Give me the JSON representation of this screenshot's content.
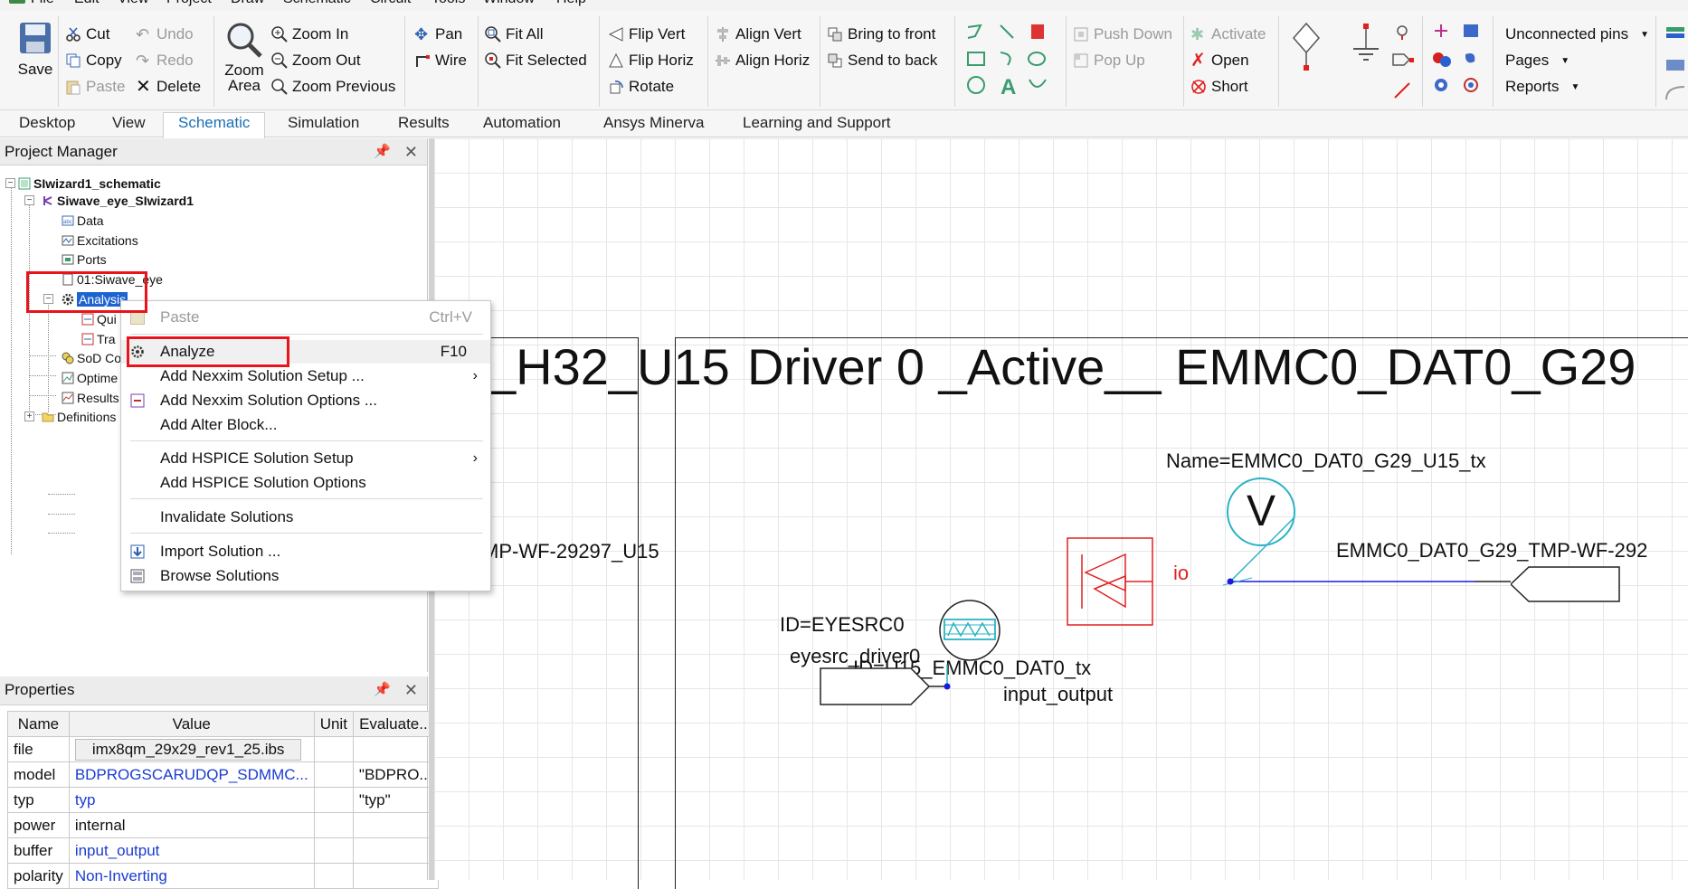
{
  "menubar": [
    "File",
    "Edit",
    "View",
    "Project",
    "Draw",
    "Schematic",
    "Circuit",
    "Tools",
    "Window",
    "Help"
  ],
  "ribbon": {
    "save": "Save",
    "cut": "Cut",
    "copy": "Copy",
    "paste": "Paste",
    "undo": "Undo",
    "redo": "Redo",
    "delete": "Delete",
    "zoom_area_1": "Zoom",
    "zoom_area_2": "Area",
    "zoom_in": "Zoom In",
    "zoom_out": "Zoom Out",
    "zoom_previous": "Zoom Previous",
    "pan": "Pan",
    "wire": "Wire",
    "fit_all": "Fit All",
    "fit_selected": "Fit Selected",
    "flip_vert": "Flip Vert",
    "flip_horiz": "Flip Horiz",
    "rotate": "Rotate",
    "align_vert": "Align Vert",
    "align_horiz": "Align Horiz",
    "bring_to_front": "Bring to front",
    "send_to_back": "Send to back",
    "push_down": "Push Down",
    "pop_up": "Pop Up",
    "activate": "Activate",
    "open": "Open",
    "short": "Short",
    "unconnected_pins": "Unconnected pins",
    "pages": "Pages",
    "reports": "Reports"
  },
  "tabs": [
    "Desktop",
    "View",
    "Schematic",
    "Simulation",
    "Results",
    "Automation",
    "Ansys Minerva",
    "Learning and Support"
  ],
  "active_tab": "Schematic",
  "project_manager": {
    "title": "Project Manager",
    "tree": {
      "root": "SIwizard1_schematic",
      "design": "Siwave_eye_SIwizard1",
      "data": "Data",
      "excitations": "Excitations",
      "ports": "Ports",
      "schematic_page": "01:Siwave_eye",
      "analysis": "Analysis",
      "qui": "Qui",
      "tra": "Tra",
      "sod": "SoD Co",
      "optime": "Optime",
      "results": "Results",
      "definitions": "Definitions"
    }
  },
  "context_menu": {
    "paste": "Paste",
    "paste_shortcut": "Ctrl+V",
    "analyze": "Analyze",
    "analyze_shortcut": "F10",
    "add_nexxim_setup": "Add Nexxim Solution Setup ...",
    "add_nexxim_options": "Add Nexxim Solution Options ...",
    "add_alter_block": "Add Alter Block...",
    "add_hspice_setup": "Add HSPICE Solution Setup",
    "add_hspice_options": "Add HSPICE Solution Options",
    "invalidate": "Invalidate Solutions",
    "import_solution": "Import Solution ...",
    "browse_solutions": "Browse Solutions"
  },
  "properties": {
    "title": "Properties",
    "headers": [
      "Name",
      "Value",
      "Unit",
      "Evaluate..."
    ],
    "rows": [
      {
        "name": "file",
        "value": "imx8qm_29x29_rev1_25.ibs",
        "unit": "",
        "eval": ""
      },
      {
        "name": "model",
        "value": "BDPROGSCARUDQP_SDMMC...",
        "unit": "",
        "eval": "\"BDPRO..."
      },
      {
        "name": "typ",
        "value": "typ",
        "unit": "",
        "eval": "\"typ\""
      },
      {
        "name": "power",
        "value": "internal",
        "unit": "",
        "eval": ""
      },
      {
        "name": "buffer",
        "value": "input_output",
        "unit": "",
        "eval": ""
      },
      {
        "name": "polarity",
        "value": "Non-Inverting",
        "unit": "",
        "eval": ""
      }
    ]
  },
  "schematic": {
    "title_left": "_H32_U15",
    "title_right": "Driver 0 _Active__ EMMC0_DAT0_G29",
    "left_port_label": "MP-WF-29297_U15",
    "probe_name": "Name=EMMC0_DAT0_G29_U15_tx",
    "probe_symbol": "V",
    "io_label": "io",
    "right_port_label": "EMMC0_DAT0_G29_TMP-WF-292",
    "eyesrc_id": "ID=EYESRC0",
    "eyesrc_name": "eyesrc_driver0",
    "driver_id": "ID=U15_EMMC0_DAT0_tx",
    "driver_buffer": "input_output"
  },
  "colors": {
    "highlight_red": "#e8131b",
    "selection_blue": "#1a6fb5",
    "driver_red": "#e02020",
    "probe_teal": "#2bb3c6",
    "wire_blue": "#1a1adf"
  }
}
